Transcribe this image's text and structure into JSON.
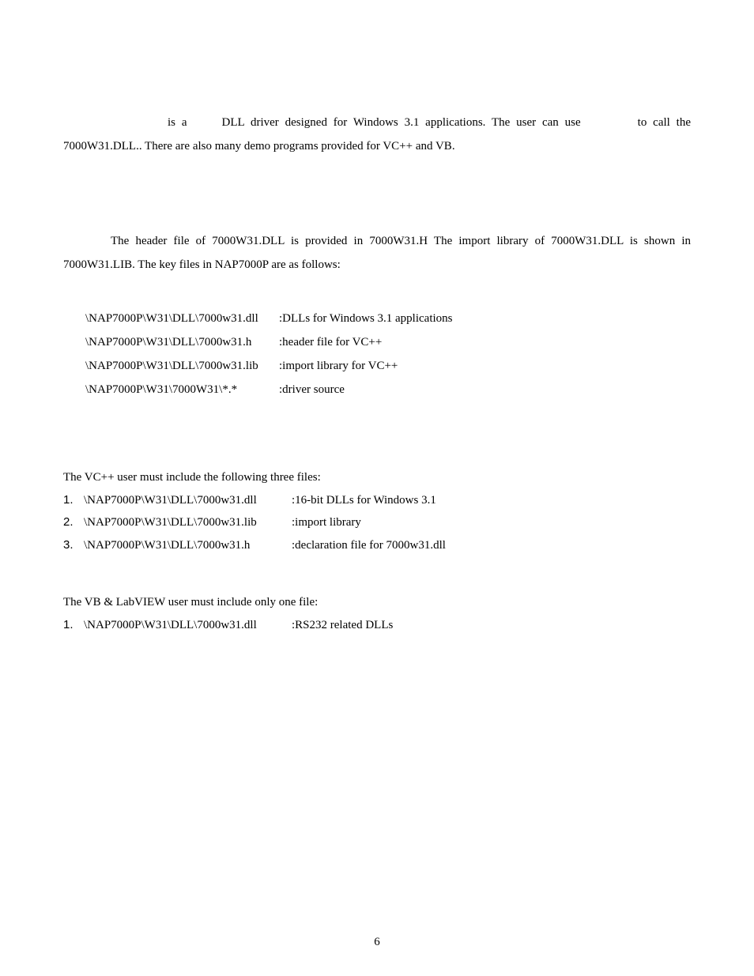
{
  "para1": {
    "isA": "is a",
    "mid": "DLL driver designed for Windows 3.1 applications. The user can use",
    "end": "to call the 7000W31.DLL.. There are also many demo programs provided for VC++ and VB."
  },
  "para2": "The header file of 7000W31.DLL is provided in 7000W31.H  The import library of 7000W31.DLL is shown in 7000W31.LIB.  The key files in NAP7000P are as follows:",
  "files": [
    {
      "path": "\\NAP7000P\\W31\\DLL\\7000w31.dll",
      "desc": ":DLLs for Windows 3.1 applications"
    },
    {
      "path": "\\NAP7000P\\W31\\DLL\\7000w31.h",
      "desc": ":header file for VC++"
    },
    {
      "path": "\\NAP7000P\\W31\\DLL\\7000w31.lib",
      "desc": ":import library for VC++"
    },
    {
      "path": "\\NAP7000P\\W31\\7000W31\\*.*",
      "desc": ":driver source"
    }
  ],
  "vc": {
    "intro": "The VC++ user must include the following three files:",
    "items": [
      {
        "num": "1.",
        "path": "\\NAP7000P\\W31\\DLL\\7000w31.dll",
        "desc": ":16-bit DLLs for Windows 3.1"
      },
      {
        "num": "2.",
        "path": "\\NAP7000P\\W31\\DLL\\7000w31.lib",
        "desc": ":import library"
      },
      {
        "num": "3.",
        "path": "\\NAP7000P\\W31\\DLL\\7000w31.h",
        "desc": ":declaration file for 7000w31.dll"
      }
    ]
  },
  "vb": {
    "intro": "The VB & LabVIEW user must include only one file:",
    "items": [
      {
        "num": "1.",
        "path": "\\NAP7000P\\W31\\DLL\\7000w31.dll",
        "desc": ":RS232 related DLLs"
      }
    ]
  },
  "pageNumber": "6"
}
